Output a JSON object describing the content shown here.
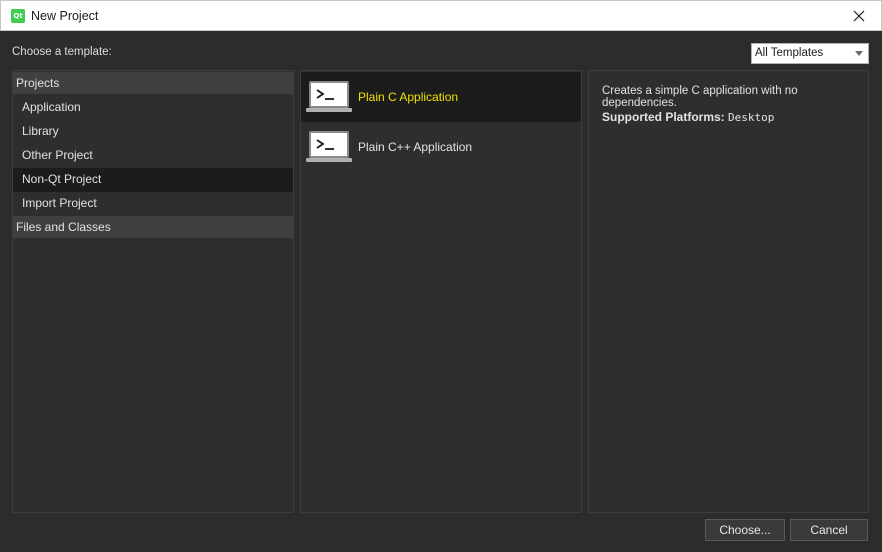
{
  "window": {
    "title": "New Project",
    "app_icon_text": "Qt"
  },
  "toolbar": {
    "choose_template_label": "Choose a template:",
    "filter_value": "All Templates"
  },
  "categories": [
    {
      "label": "Projects",
      "children": [
        "Application",
        "Library",
        "Other Project",
        "Non-Qt Project",
        "Import Project"
      ],
      "selected_child": "Non-Qt Project"
    },
    {
      "label": "Files and Classes",
      "children": []
    }
  ],
  "templates": [
    {
      "label": "Plain C Application",
      "selected": true,
      "icon": "terminal-laptop-icon"
    },
    {
      "label": "Plain C++ Application",
      "selected": false,
      "icon": "terminal-laptop-icon"
    }
  ],
  "details": {
    "description": "Creates a simple C application with no dependencies.",
    "platforms_label": "Supported Platforms:",
    "platforms_value": "Desktop"
  },
  "buttons": {
    "choose": "Choose...",
    "cancel": "Cancel"
  },
  "colors": {
    "selected_text": "#f0e000",
    "background": "#2c2c2c",
    "selected_row": "#1c1c1c"
  }
}
